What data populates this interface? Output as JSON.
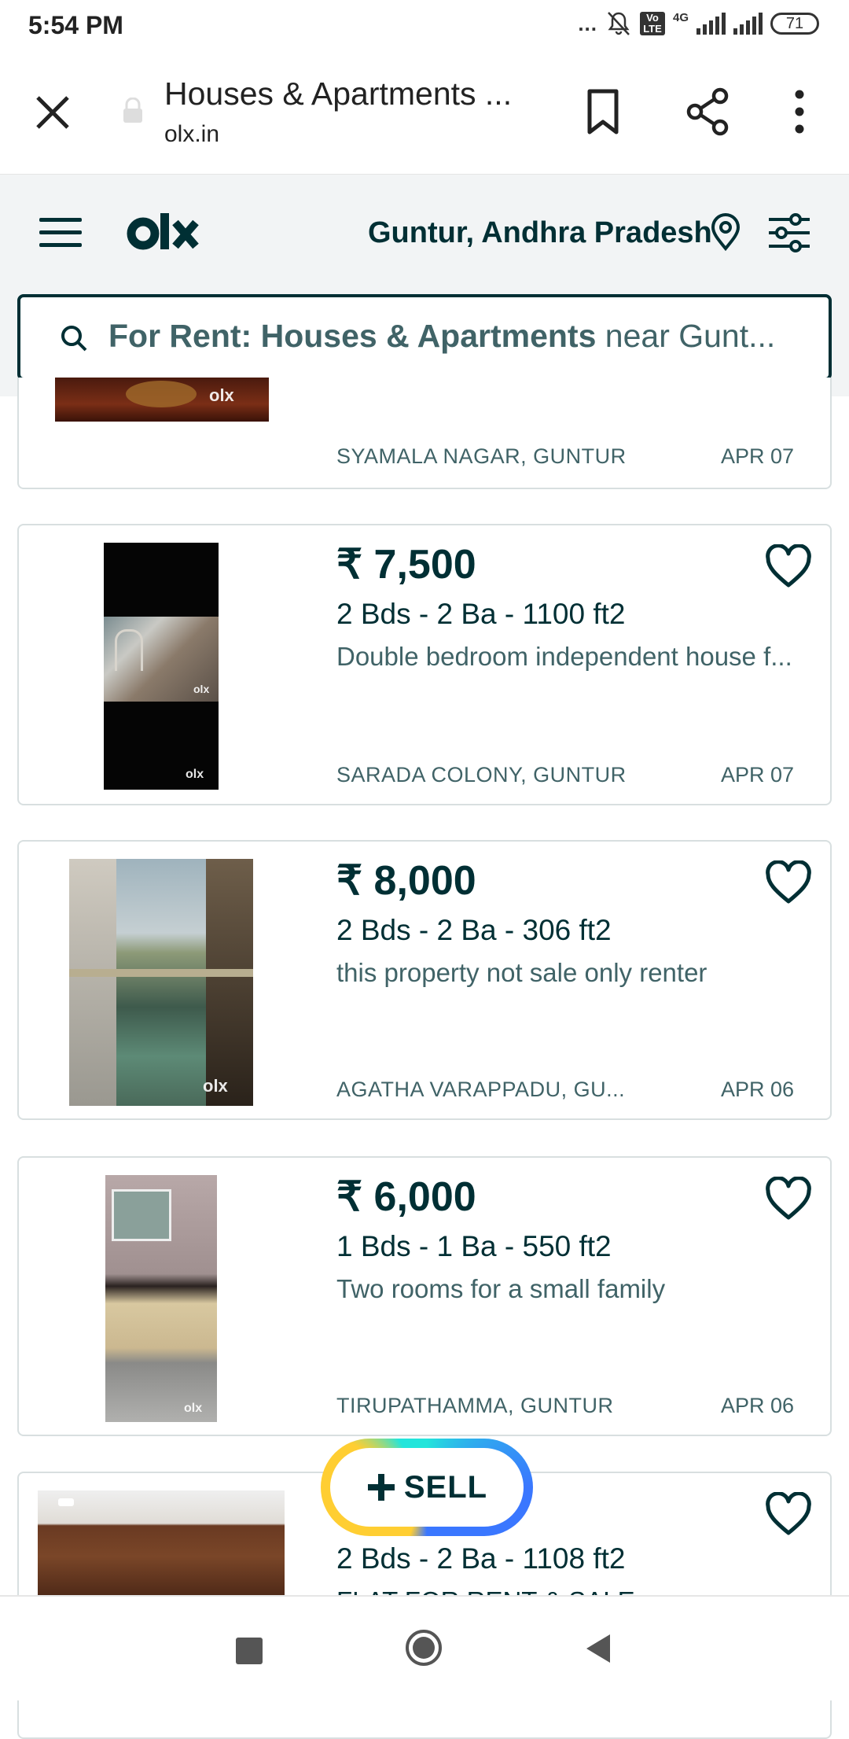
{
  "status_bar": {
    "time": "5:54 PM",
    "dots": "...",
    "volte": "Vo LTE",
    "network": "4G",
    "battery": "71"
  },
  "browser": {
    "page_title": "Houses & Apartments ...",
    "url": "olx.in"
  },
  "header": {
    "logo": "olx",
    "location": "Guntur, Andhra Pradesh",
    "search": {
      "bold_part": "For Rent: Houses & Apartments",
      "rest": " near Gunt..."
    }
  },
  "listings": [
    {
      "location": "SYAMALA NAGAR, GUNTUR",
      "date": "APR 07"
    },
    {
      "price": "₹ 7,500",
      "specs": "2 Bds - 2 Ba - 1100 ft2",
      "description": "Double bedroom independent house f...",
      "location": "SARADA COLONY, GUNTUR",
      "date": "APR 07"
    },
    {
      "price": "₹ 8,000",
      "specs": "2 Bds - 2 Ba - 306 ft2",
      "description": "this property not sale only renter",
      "location": "AGATHA VARAPPADU, GU...",
      "date": "APR 06"
    },
    {
      "price": "₹ 6,000",
      "specs": "1 Bds - 1 Ba - 550 ft2",
      "description": "Two rooms for a small family",
      "location": "TIRUPATHAMMA, GUNTUR",
      "date": "APR 06"
    },
    {
      "specs": "2 Bds - 2 Ba - 1108 ft2",
      "description": "FLAT FOR RENT & SALE"
    }
  ],
  "sell_button": {
    "label": "SELL"
  },
  "watermark": "olx",
  "icons": {
    "close": "close-icon",
    "lock": "lock-icon",
    "bookmark": "bookmark-icon",
    "share": "share-icon",
    "more": "more-vert-icon",
    "menu": "hamburger-menu-icon",
    "pin": "location-pin-icon",
    "filter": "filter-sliders-icon",
    "search": "search-icon",
    "favorite": "heart-outline-icon"
  },
  "colors": {
    "brand_dark": "#002f34",
    "secondary_text": "#406367",
    "header_bg": "#f2f4f5",
    "sell_ring_teal": "#23e5db",
    "sell_ring_blue": "#3a77ff",
    "sell_ring_yellow": "#ffce32"
  }
}
